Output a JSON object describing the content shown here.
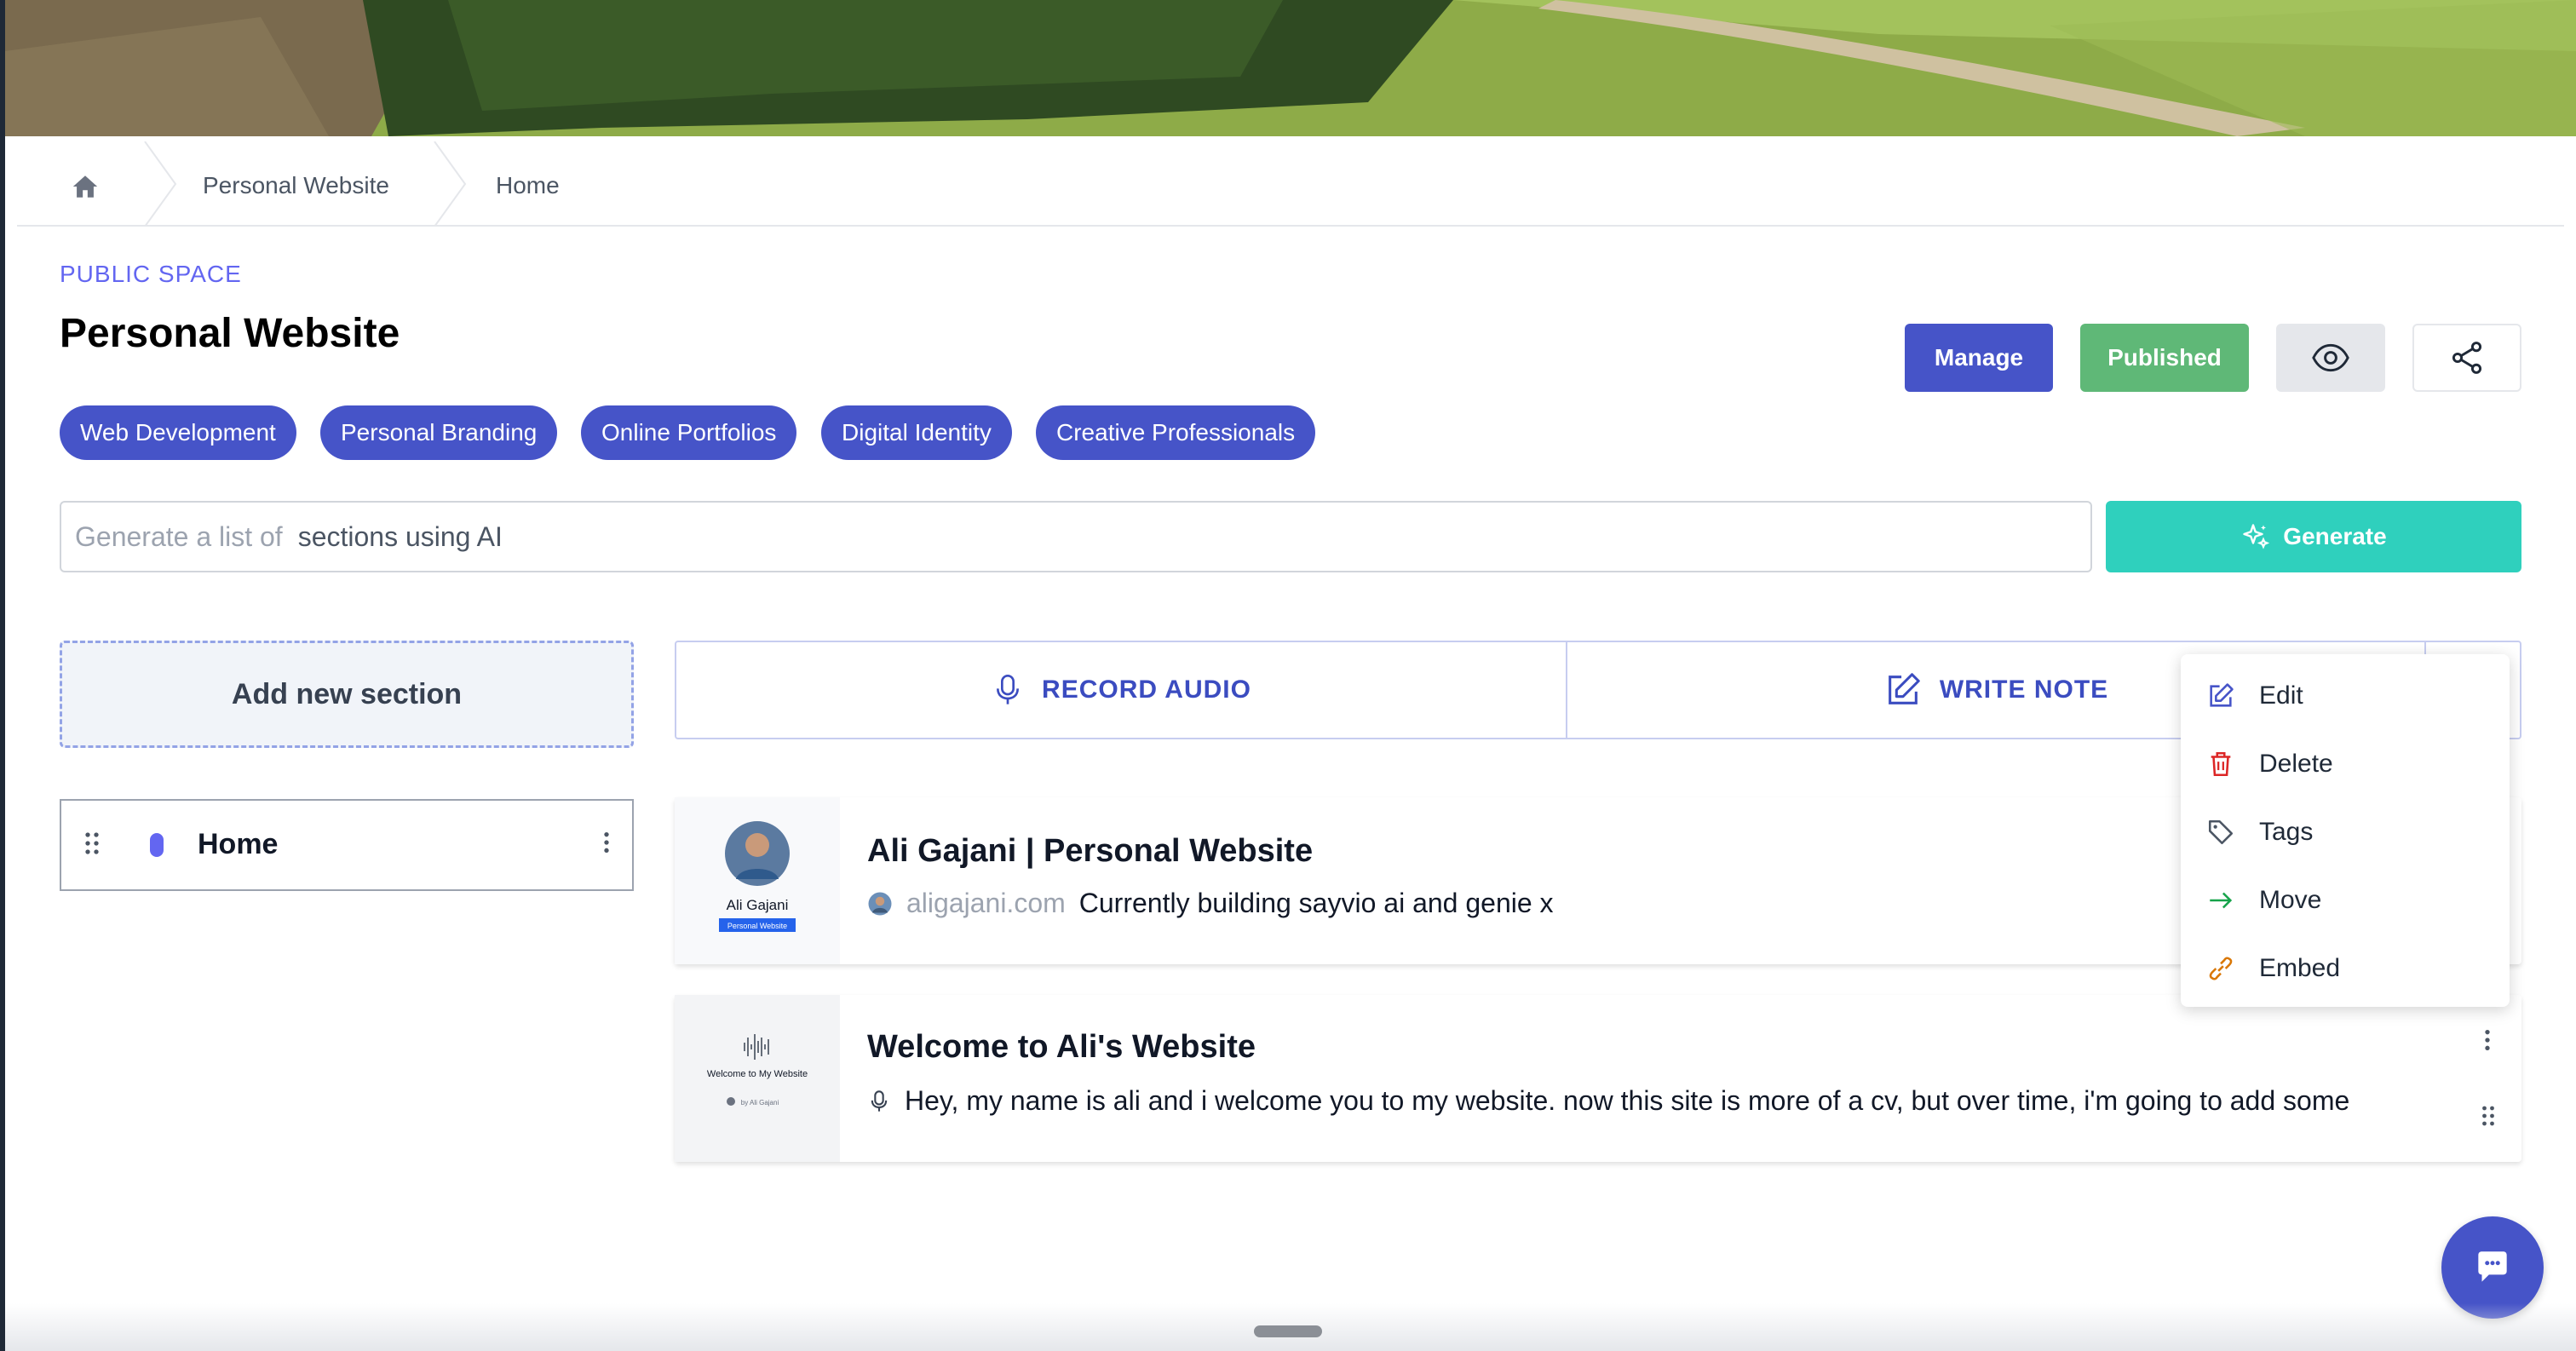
{
  "breadcrumb": {
    "items": [
      "Personal Website",
      "Home"
    ]
  },
  "space": {
    "label": "PUBLIC SPACE",
    "title": "Personal Website"
  },
  "header_actions": {
    "manage": "Manage",
    "published": "Published"
  },
  "tags": [
    "Web Development",
    "Personal Branding",
    "Online Portfolios",
    "Digital Identity",
    "Creative Professionals"
  ],
  "generate": {
    "prefix": "Generate a list of",
    "value": "sections using AI",
    "button": "Generate"
  },
  "sidebar": {
    "add_section": "Add new section",
    "sections": [
      {
        "label": "Home",
        "color": "#6366f1"
      }
    ]
  },
  "actions": {
    "record_audio": "RECORD AUDIO",
    "write_note": "WRITE NOTE"
  },
  "cards": [
    {
      "title": "Ali Gajani | Personal Website",
      "link": "aligajani.com",
      "text": "Currently building sayvio ai and genie x",
      "thumb_name": "Ali Gajani",
      "thumb_badge": "Personal Website"
    },
    {
      "title": "Welcome to Ali's Website",
      "text": "Hey, my name is ali and i welcome you to my website. now this site is more of a cv, but over time, i'm going to add some",
      "thumb_title": "Welcome to My Website",
      "thumb_by": "by Ali Gajani"
    }
  ],
  "context_menu": {
    "items": [
      "Edit",
      "Delete",
      "Tags",
      "Move",
      "Embed"
    ]
  },
  "colors": {
    "primary": "#4654c8",
    "published": "#5fb877",
    "generate": "#2fd0bd",
    "accent": "#6366f1"
  }
}
